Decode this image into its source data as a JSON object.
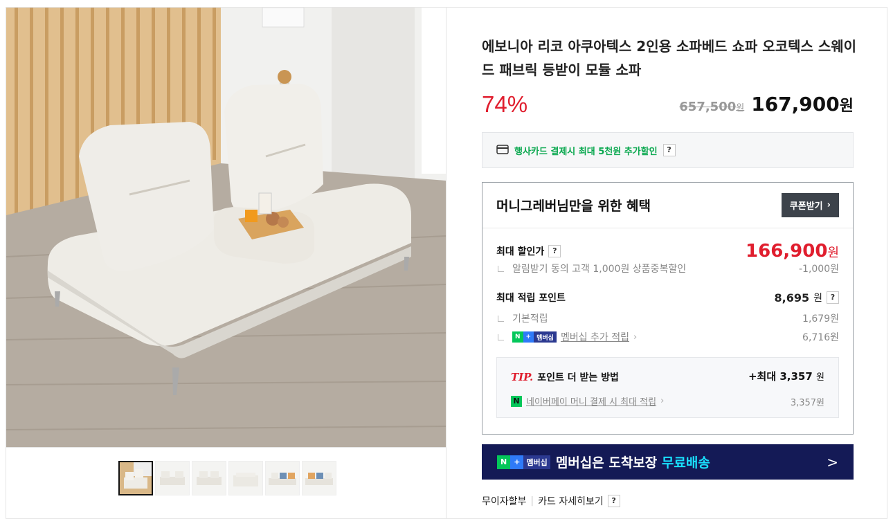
{
  "product": {
    "title": "에보니아 리코 아쿠아텍스 2인용 소파베드 쇼파 오코텍스 스웨이드 패브릭 등받이 모듈 소파",
    "discount_rate": "74%",
    "original_price": "657,500",
    "original_unit": "원",
    "sale_price": "167,900",
    "sale_unit": "원"
  },
  "card_banner": {
    "text": "행사카드 결제시 최대 5천원 추가할인",
    "help": "?",
    "icon": "credit-card-icon"
  },
  "benefits": {
    "heading": "머니그레버님만을 위한 혜택",
    "coupon_button": "쿠폰받기",
    "max_discount_label": "최대 할인가",
    "max_discount_help": "?",
    "max_discount_price": "166,900",
    "max_discount_unit": "원",
    "alarm_label": "알림받기 동의 고객 1,000원 상품중복할인",
    "alarm_value": "-1,000원",
    "max_points_label": "최대 적립 포인트",
    "max_points_value": "8,695",
    "max_points_unit": "원",
    "max_points_help": "?",
    "basic_label": "기본적립",
    "basic_value": "1,679원",
    "membership_badge": {
      "n": "N",
      "plus": "+",
      "text": "멤버십"
    },
    "membership_label": "멤버십 추가 적립",
    "membership_value": "6,716원",
    "tip": {
      "tip_word": "TIP.",
      "title": "포인트 더 받는 방법",
      "max_label": "+최대 3,357",
      "max_unit": "원",
      "npay_icon": "N",
      "npay_label": "네이버페이 머니 결제 시 최대 적립",
      "npay_value": "3,357원"
    }
  },
  "shipping_banner": {
    "badge": {
      "n": "N",
      "plus": "+",
      "text": "멤버십"
    },
    "text": "멤버십은 도착보장",
    "highlight": "무료배송",
    "arrow": ">"
  },
  "bottom_links": {
    "installment": "무이자할부",
    "card_detail": "카드 자세히보기",
    "help": "?"
  },
  "gallery": {
    "thumbnail_count": 6,
    "active_index": 0
  },
  "colors": {
    "discount_red": "#e01e2e",
    "card_green": "#0aa84f",
    "naver_green": "#03c75a",
    "banner_navy": "#141a56",
    "banner_highlight": "#19e0ff"
  }
}
